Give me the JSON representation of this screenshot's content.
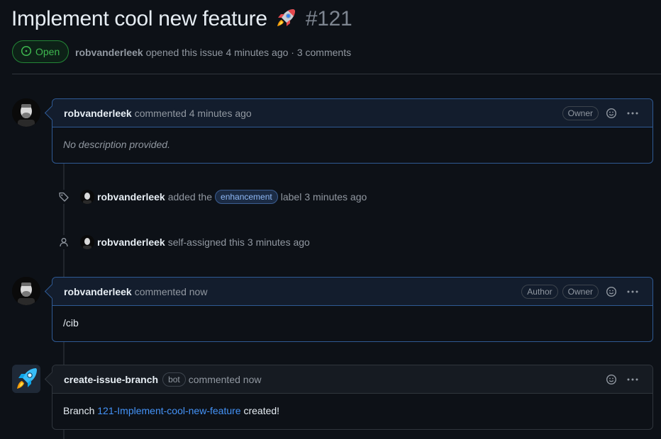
{
  "issue": {
    "title": "Implement cool new feature",
    "number": "#121",
    "state": "Open",
    "author": "robvanderleek",
    "meta_text": "opened this issue 4 minutes ago · 3 comments"
  },
  "comments": [
    {
      "author": "robvanderleek",
      "action": "commented 4 minutes ago",
      "badges": [
        "Owner"
      ],
      "body": "No description provided."
    },
    {
      "author": "robvanderleek",
      "action": "commented now",
      "badges": [
        "Author",
        "Owner"
      ],
      "body": "/cib"
    },
    {
      "author": "create-issue-branch",
      "bot_badge": "bot",
      "action": "commented now",
      "body_prefix": "Branch",
      "branch_link": "121-Implement-cool-new-feature",
      "body_suffix": "created!"
    }
  ],
  "events": [
    {
      "actor": "robvanderleek",
      "text_before": "added the",
      "label": "enhancement",
      "text_after": "label",
      "time": "3 minutes ago",
      "icon": "tag-icon"
    },
    {
      "actor": "robvanderleek",
      "text_before": "self-assigned this",
      "time": "3 minutes ago",
      "icon": "person-icon"
    }
  ],
  "colors": {
    "background": "#0d1117",
    "open_green": "#3fb950",
    "link_blue": "#4493f8",
    "owner_comment_border": "#2f5a94",
    "label_enhancement": "#8fb8f5"
  }
}
